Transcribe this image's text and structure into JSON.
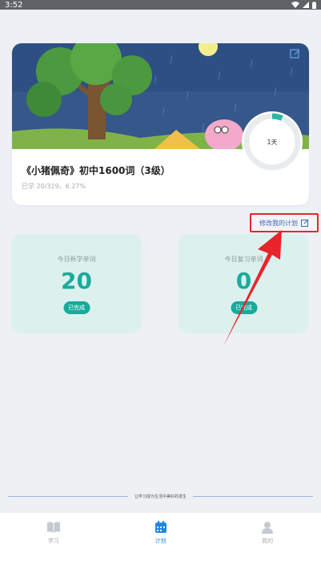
{
  "status_bar": {
    "time": "3:52"
  },
  "book": {
    "title": "《小猪佩奇》初中1600词（3级）",
    "progress_text": "已学 20/319，6.27%",
    "days_label": "1天",
    "progress_fraction": 0.0627
  },
  "modify_plan": {
    "label": "修改我的计划"
  },
  "stats": [
    {
      "label": "今日新学单词",
      "value": "20",
      "badge": "已完成"
    },
    {
      "label": "今日复习单词",
      "value": "0",
      "badge": "已完成"
    }
  ],
  "footer": {
    "text": "让学习成为生活中美好的发生"
  },
  "nav": {
    "items": [
      {
        "label": "学习",
        "icon": "book-icon"
      },
      {
        "label": "计划",
        "icon": "calendar-icon"
      },
      {
        "label": "我的",
        "icon": "person-icon"
      }
    ]
  },
  "colors": {
    "accent": "#1aab9c",
    "nav_active": "#1e88e5",
    "highlight": "#e8242a"
  }
}
